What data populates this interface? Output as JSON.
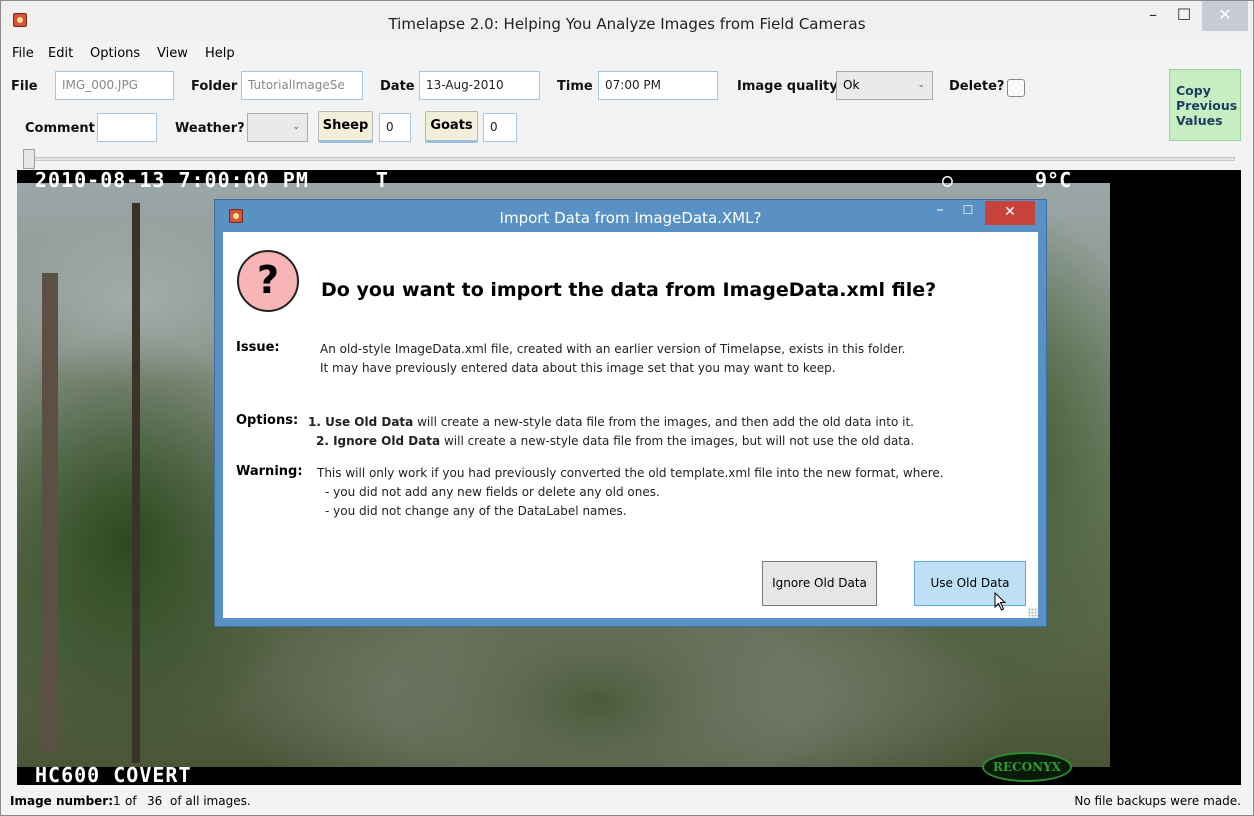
{
  "window": {
    "title": "Timelapse 2.0: Helping You Analyze Images from Field Cameras",
    "min_glyph": "–",
    "max_glyph": "☐",
    "close_glyph": "✕"
  },
  "menu": [
    "File",
    "Edit",
    "Options",
    "View",
    "Help"
  ],
  "fields": {
    "file_label": "File",
    "file_value": "IMG_000.JPG",
    "folder_label": "Folder",
    "folder_value": "TutorialImageSe",
    "date_label": "Date",
    "date_value": "13-Aug-2010",
    "time_label": "Time",
    "time_value": "07:00 PM",
    "quality_label": "Image quality",
    "quality_value": "Ok",
    "delete_label": "Delete?",
    "comment_label": "Comment",
    "comment_value": "",
    "weather_label": "Weather?",
    "weather_value": "",
    "sheep_label": "Sheep",
    "sheep_count": "0",
    "goats_label": "Goats",
    "goats_count": "0",
    "copy_button": [
      "Copy",
      "Previous",
      "Values"
    ]
  },
  "camera_overlay": {
    "timestamp": "2010-08-13 7:00:00 PM",
    "marker": "T",
    "moon": "○",
    "temperature": "9°C",
    "model": "HC600 COVERT",
    "brand": "RECONYX"
  },
  "status": {
    "image_number_label": "Image number:",
    "image_index": "1",
    "of_word": "of",
    "image_total": "36",
    "suffix": "of all images.",
    "backups": "No file backups were made."
  },
  "dialog": {
    "title": "Import Data from ImageData.XML?",
    "icon_glyph": "?",
    "heading": "Do you want to import the data from ImageData.xml file?",
    "issue_label": "Issue:",
    "issue_line1": "An old-style ImageData.xml file, created with an earlier version of Timelapse, exists in this folder.",
    "issue_line2": "It may have previously entered data about this image set that you may want to keep.",
    "options_label": "Options:",
    "opt1_bold": "1. Use Old Data",
    "opt1_text": " will create a new-style data file from the images, and then add the old data into it.",
    "opt2_bold": "2. Ignore Old Data",
    "opt2_text": " will create a new-style data file from the images, but will not use the old data.",
    "warning_label": "Warning:",
    "warning_line1": "This will only work if you had previously converted the old template.xml file into the new format, where.",
    "warning_line2": "- you did not add any new fields or delete any old ones.",
    "warning_line3": "- you did not change any of the DataLabel names.",
    "ignore_button": "Ignore Old Data",
    "use_button": "Use Old Data"
  }
}
